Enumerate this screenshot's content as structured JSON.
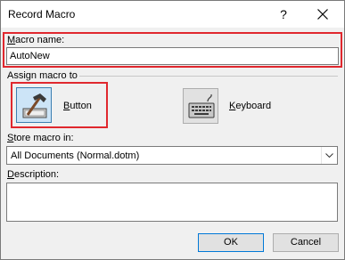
{
  "window": {
    "title": "Record Macro",
    "help_glyph": "?",
    "close_icon": "close-icon"
  },
  "macro_name": {
    "label_u": "M",
    "label_rest": "acro name:",
    "value": "AutoNew"
  },
  "assign": {
    "label": "Assign macro to",
    "button": {
      "label_u": "B",
      "label_rest": "utton",
      "icon": "button-hammer-icon"
    },
    "keyboard": {
      "label_u": "K",
      "label_rest": "eyboard",
      "icon": "keyboard-icon"
    }
  },
  "store": {
    "label_u": "S",
    "label_rest": "tore macro in:",
    "selected": "All Documents (Normal.dotm)"
  },
  "description": {
    "label_u": "D",
    "label_rest": "escription:",
    "value": ""
  },
  "footer": {
    "ok_label": "OK",
    "cancel_label": "Cancel"
  },
  "colors": {
    "highlight": "#e0282e",
    "selected_tile": "#cce4f7",
    "default_button_border": "#0078d7"
  }
}
